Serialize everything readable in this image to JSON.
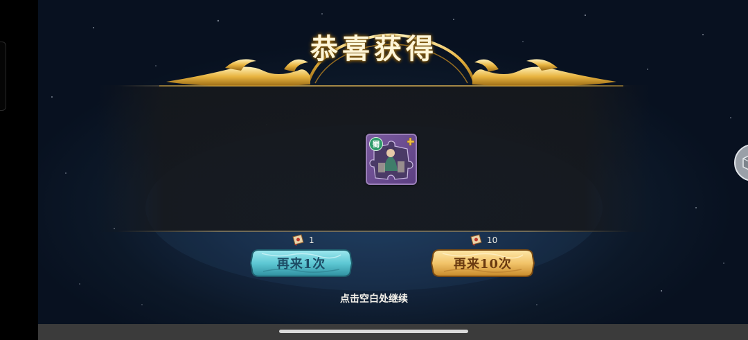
{
  "title": "恭喜获得",
  "reward": {
    "faction_badge": "蜀",
    "icon": "general-fragment-icon",
    "rarity_color": "#7a5a9e"
  },
  "draw_once": {
    "label": "再来1次",
    "cost": "1",
    "cost_icon": "scroll-ticket-icon",
    "color": "#5ec8d4"
  },
  "draw_ten": {
    "label": "再来10次",
    "cost": "10",
    "cost_icon": "scroll-ticket-icon",
    "color": "#f2c46a"
  },
  "hint": "点击空白处继续",
  "colors": {
    "title_glow": "#c28a1c",
    "background": "#14263f"
  }
}
